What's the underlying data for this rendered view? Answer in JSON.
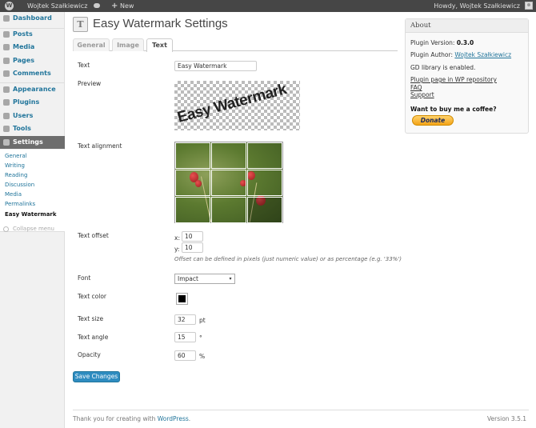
{
  "adminbar": {
    "site_name": "Wojtek Szałkiewicz",
    "new_label": "New",
    "greeting": "Howdy, Wojtek Szałkiewicz"
  },
  "sidebar": {
    "items": [
      {
        "label": "Dashboard"
      },
      {
        "label": "Posts"
      },
      {
        "label": "Media"
      },
      {
        "label": "Pages"
      },
      {
        "label": "Comments"
      },
      {
        "label": "Appearance"
      },
      {
        "label": "Plugins"
      },
      {
        "label": "Users"
      },
      {
        "label": "Tools"
      },
      {
        "label": "Settings"
      }
    ],
    "submenu": [
      "General",
      "Writing",
      "Reading",
      "Discussion",
      "Media",
      "Permalinks",
      "Easy Watermark"
    ],
    "collapse_label": "Collapse menu"
  },
  "page": {
    "title": "Easy Watermark Settings",
    "tabs": [
      "General",
      "Image",
      "Text"
    ]
  },
  "form": {
    "text_label": "Text",
    "text_value": "Easy Watermark",
    "preview_label": "Preview",
    "preview_text": "Easy Watermark",
    "alignment_label": "Text alignment",
    "offset_label": "Text offset",
    "offset_x_label": "x:",
    "offset_x_value": "10",
    "offset_y_label": "y:",
    "offset_y_value": "10",
    "offset_hint": "Offset can be defined in pixels (just numeric value) or as percentage (e.g. '33%')",
    "font_label": "Font",
    "font_value": "Impact",
    "color_label": "Text color",
    "color_value": "#000000",
    "size_label": "Text size",
    "size_value": "32",
    "size_unit": "pt",
    "angle_label": "Text angle",
    "angle_value": "15",
    "angle_unit": "°",
    "opacity_label": "Opacity",
    "opacity_value": "60",
    "opacity_unit": "%",
    "save_label": "Save Changes"
  },
  "about": {
    "title": "About",
    "version_label": "Plugin Version:",
    "version_value": "0.3.0",
    "author_label": "Plugin Author:",
    "author_value": "Wojtek Szałkiewicz",
    "gd_status": "GD library is enabled.",
    "link_repo": "Plugin page in WP repository",
    "link_faq": "FAQ",
    "link_support": "Support",
    "coffee": "Want to buy me a coffee?",
    "donate_label": "Donate"
  },
  "footer": {
    "thanks_prefix": "Thank you for creating with",
    "thanks_link": "WordPress",
    "thanks_suffix": ".",
    "version": "Version 3.5.1"
  },
  "colors": {
    "link": "#21759b",
    "adminbar_bg": "#464646",
    "active_menu_bg": "#6d6d6d",
    "primary_button": "#2e8cc0"
  }
}
